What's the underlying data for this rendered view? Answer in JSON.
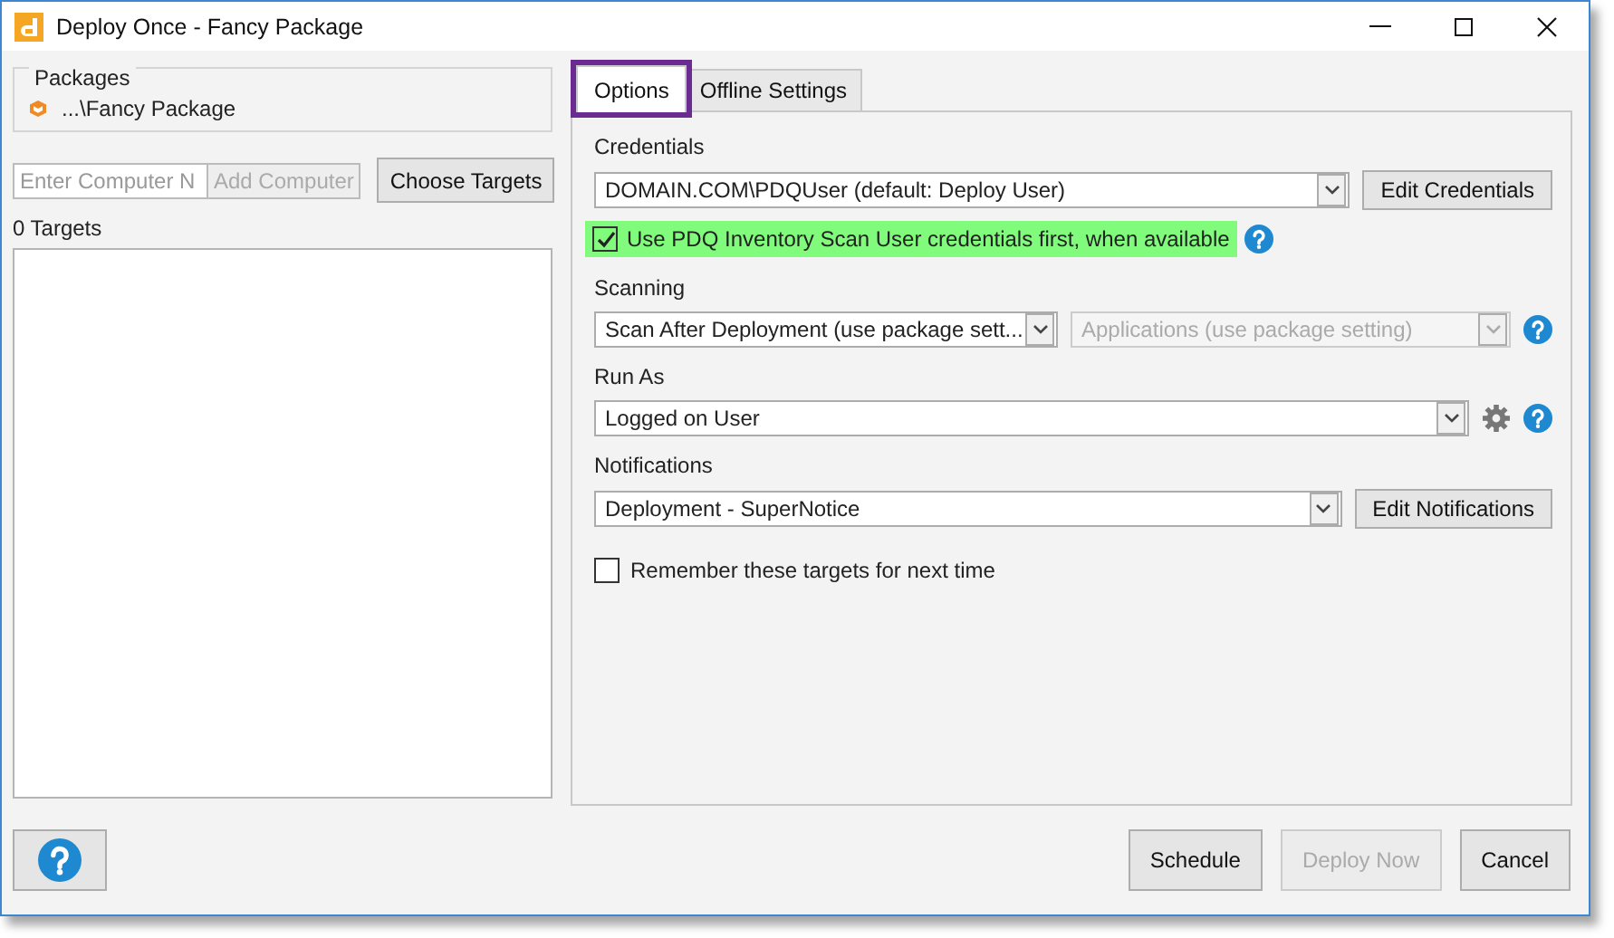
{
  "window": {
    "title": "Deploy Once - Fancy Package"
  },
  "packages": {
    "label": "Packages",
    "items": [
      "...\\Fancy Package"
    ]
  },
  "computer_field": {
    "placeholder": "Enter Computer N"
  },
  "add_computer_button": {
    "label": "Add Computer",
    "disabled": true
  },
  "choose_targets_button": {
    "label": "Choose Targets"
  },
  "targets": {
    "count": "0 Targets"
  },
  "tabs": [
    {
      "label": "Options",
      "selected": true,
      "highlighted": true
    },
    {
      "label": "Offline Settings",
      "selected": false,
      "highlighted": false
    }
  ],
  "credentials": {
    "label": "Credentials",
    "value": "DOMAIN.COM\\PDQUser (default: Deploy User)",
    "button": "Edit Credentials",
    "checkbox": {
      "label": "Use PDQ Inventory Scan User credentials first, when available",
      "checked": true,
      "highlighted": true
    }
  },
  "scanning": {
    "label": "Scanning",
    "value": "Scan After Deployment (use package sett...",
    "second_value": "Applications (use package setting)",
    "second_disabled": true
  },
  "run_as": {
    "label": "Run As",
    "value": "Logged on User"
  },
  "notifications": {
    "label": "Notifications",
    "value": "Deployment - SuperNotice",
    "button": "Edit Notifications"
  },
  "remember": {
    "label": "Remember these targets for next time",
    "checked": false
  },
  "footer_buttons": [
    {
      "label": "Schedule",
      "disabled": false
    },
    {
      "label": "Deploy Now",
      "disabled": true
    },
    {
      "label": "Cancel",
      "disabled": false
    }
  ]
}
